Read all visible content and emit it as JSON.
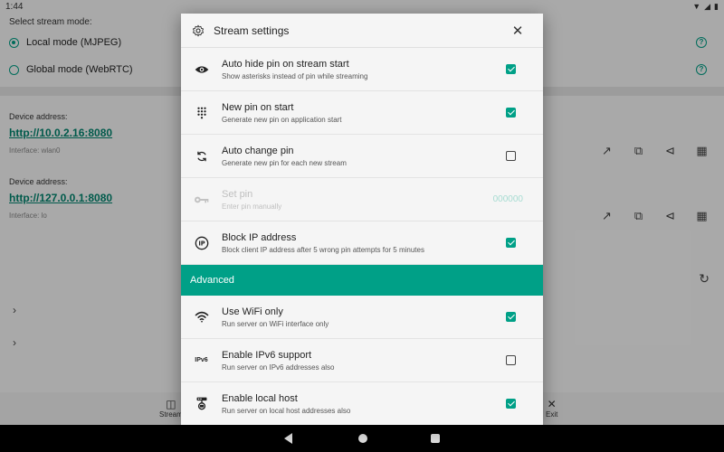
{
  "status": {
    "time": "1:44"
  },
  "background": {
    "mode_label": "Select stream mode:",
    "modes": [
      {
        "label": "Local mode (MJPEG)",
        "selected": true
      },
      {
        "label": "Global mode (WebRTC)",
        "selected": false
      }
    ],
    "devices": [
      {
        "label": "Device address:",
        "url": "http://10.0.2.16:8080",
        "iface": "Interface: wlan0"
      },
      {
        "label": "Device address:",
        "url": "http://127.0.0.1:8080",
        "iface": "Interface: lo"
      }
    ],
    "nav": {
      "stream_label": "Stream",
      "exit_label": "Exit"
    }
  },
  "dialog": {
    "title": "Stream settings",
    "items": [
      {
        "title": "Auto hide pin on stream start",
        "subtitle": "Show asterisks instead of pin while streaming",
        "icon": "eye-icon",
        "checked": true
      },
      {
        "title": "New pin on start",
        "subtitle": "Generate new pin on application start",
        "icon": "dialpad-icon",
        "checked": true
      },
      {
        "title": "Auto change pin",
        "subtitle": "Generate new pin for each new stream",
        "icon": "sync-icon",
        "checked": false
      },
      {
        "title": "Set pin",
        "subtitle": "Enter pin manually",
        "icon": "key-icon",
        "value": "000000",
        "disabled": true
      },
      {
        "title": "Block IP address",
        "subtitle": "Block client IP address after 5 wrong pin attempts for 5 minutes",
        "icon": "ip-icon",
        "checked": true
      }
    ],
    "advanced_label": "Advanced",
    "advanced_items": [
      {
        "title": "Use WiFi only",
        "subtitle": "Run server on WiFi interface only",
        "icon": "wifi-icon",
        "checked": true
      },
      {
        "title": "Enable IPv6 support",
        "subtitle": "Run server on IPv6 addresses also",
        "icon": "ipv6-icon",
        "icon_text": "IPv6",
        "checked": false
      },
      {
        "title": "Enable local host",
        "subtitle": "Run server on local host addresses also",
        "icon": "localhost-icon",
        "checked": true
      }
    ]
  },
  "colors": {
    "accent": "#00a087",
    "link": "#00856f"
  }
}
